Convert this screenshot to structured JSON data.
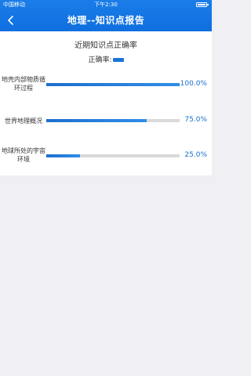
{
  "status_bar": {
    "carrier": "中国移动",
    "time": "下午2:30"
  },
  "header": {
    "title": "地理--知识点报告",
    "back_icon": "chevron-left-icon"
  },
  "card": {
    "title": "近期知识点正确率",
    "legend_label": "正确率:"
  },
  "colors": {
    "header_bg": "#1a7de8",
    "bar": "#1a74d6",
    "track": "#d9d9d9",
    "value_text": "#1a6fcf"
  },
  "chart_data": {
    "type": "bar",
    "orientation": "horizontal",
    "categories": [
      "地壳内部物质循环过程",
      "世界地理概况",
      "地球所处的宇宙环境"
    ],
    "series": [
      {
        "name": "正确率",
        "values": [
          100.0,
          75.0,
          25.0
        ]
      }
    ],
    "value_labels": [
      "100.0%",
      "75.0%",
      "25.0%"
    ],
    "xlim": [
      0,
      100
    ],
    "legend_position": "top-center",
    "grid": false
  }
}
